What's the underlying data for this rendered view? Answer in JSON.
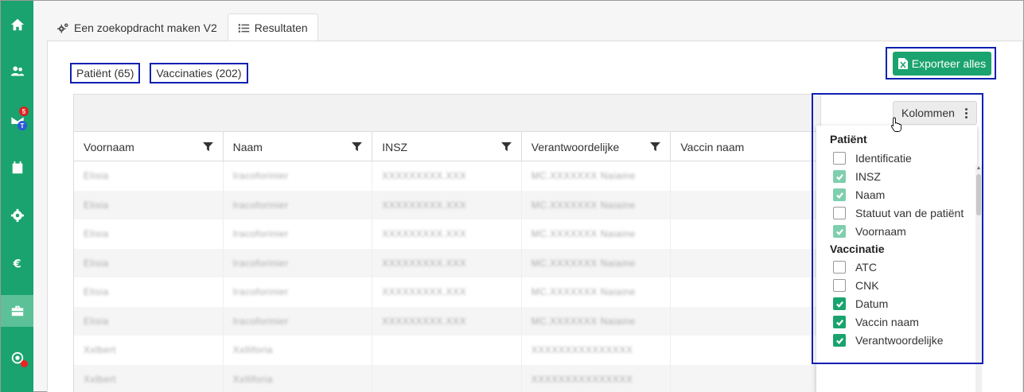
{
  "sidebar": {
    "items": [
      {
        "icon": "home-icon"
      },
      {
        "icon": "users-icon"
      },
      {
        "icon": "mail-icon",
        "badge_top": "5",
        "badge_bottom": "T"
      },
      {
        "icon": "calendar-icon"
      },
      {
        "icon": "gear-icon"
      },
      {
        "icon": "euro-icon"
      },
      {
        "icon": "briefcase-icon",
        "active": true
      },
      {
        "icon": "support-icon",
        "status": "red"
      }
    ],
    "colors": {
      "background": "#1aa36e",
      "active": "#5cc197",
      "badge_red": "#e02020",
      "badge_blue": "#2a5bd7"
    }
  },
  "top_tabs": [
    {
      "label": "Een zoekopdracht maken V2",
      "icon": "gears-icon"
    },
    {
      "label": "Resultaten",
      "icon": "list-icon",
      "active": true
    }
  ],
  "result_tabs": [
    {
      "label": "Patiënt (65)"
    },
    {
      "label": "Vaccinaties (202)",
      "active": true
    }
  ],
  "export_button": {
    "label": "Exporteer alles",
    "icon": "excel-file-icon",
    "color": "#1aa36e"
  },
  "columns_button": {
    "label": "Kolommen"
  },
  "grid": {
    "columns": [
      {
        "label": "Voornaam",
        "filter": true
      },
      {
        "label": "Naam",
        "filter": true
      },
      {
        "label": "INSZ",
        "filter": true
      },
      {
        "label": "Verantwoordelijke",
        "filter": true
      },
      {
        "label": "Vaccin naam",
        "filter": false
      }
    ],
    "rows": [
      [
        "Elisia",
        "Iracoforinier",
        "XXXXXXXXX.XXX",
        "MC.XXXXXXX Naiaine",
        ""
      ],
      [
        "Elisia",
        "Iracoforinier",
        "XXXXXXXXX.XXX",
        "MC.XXXXXXX Naiaine",
        ""
      ],
      [
        "Elisia",
        "Iracoforinier",
        "XXXXXXXXX.XXX",
        "MC.XXXXXXX Naiaine",
        ""
      ],
      [
        "Elisia",
        "Iracoforinier",
        "XXXXXXXXX.XXX",
        "MC.XXXXXXX Naiaine",
        ""
      ],
      [
        "Elisia",
        "Iracoforinier",
        "XXXXXXXXX.XXX",
        "MC.XXXXXXX Naiaine",
        ""
      ],
      [
        "Elisia",
        "Iracoforinier",
        "XXXXXXXXX.XXX",
        "MC.XXXXXXX Naiaine",
        ""
      ],
      [
        "Xxlbert",
        "Xxlliforia",
        "",
        "XXXXXXXXXXXXXXX",
        ""
      ],
      [
        "Xxlbert",
        "Xxlliforia",
        "",
        "XXXXXXXXXXXXXXX",
        ""
      ]
    ]
  },
  "column_chooser": {
    "groups": [
      {
        "label": "Patiënt",
        "options": [
          {
            "label": "Identificatie",
            "checked": false
          },
          {
            "label": "INSZ",
            "checked": true
          },
          {
            "label": "Naam",
            "checked": true
          },
          {
            "label": "Statuut van de patiënt",
            "checked": false
          },
          {
            "label": "Voornaam",
            "checked": true
          }
        ]
      },
      {
        "label": "Vaccinatie",
        "options": [
          {
            "label": "ATC",
            "checked": false
          },
          {
            "label": "CNK",
            "checked": false
          },
          {
            "label": "Datum",
            "checked": true
          },
          {
            "label": "Vaccin naam",
            "checked": true
          },
          {
            "label": "Verantwoordelijke",
            "checked": true
          }
        ]
      }
    ]
  },
  "colors": {
    "accent": "#1aa36e",
    "highlight_border": "#1020b0"
  }
}
